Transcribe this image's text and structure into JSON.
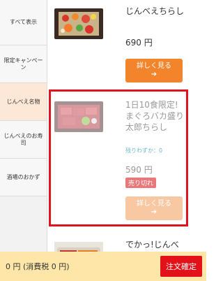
{
  "sidebar": {
    "items": [
      {
        "label": "すべて表示"
      },
      {
        "label": "限定キャンペーン"
      },
      {
        "label": "じんべえ名物"
      },
      {
        "label": "じんべえのお寿司"
      },
      {
        "label": "酒場のおかず"
      }
    ]
  },
  "products": [
    {
      "title": "じんべえちらし",
      "price": "690 円",
      "button": "詳しく見る",
      "button_arrow": "➔"
    },
    {
      "title": "1日10食限定!まぐろバカ盛り太郎ちらし",
      "remaining": "残りわずか：0",
      "price": "590 円",
      "badge": "売り切れ",
      "button": "詳しく見る",
      "button_arrow": "➔"
    },
    {
      "title": "でかっ!じんべえ"
    }
  ],
  "footer": {
    "total": "0 円 (消費税 0 円)",
    "order_button": "注文確定"
  },
  "colors": {
    "accent": "#f2842c",
    "accent_disabled": "#f8c8a3",
    "active_category": "#fde7d6",
    "selection_frame": "#e0141e",
    "order_button": "#e3121a",
    "footer_bg": "#fde6a8",
    "soldout_badge": "#e8787a",
    "remaining_text": "#6bb8c8"
  }
}
